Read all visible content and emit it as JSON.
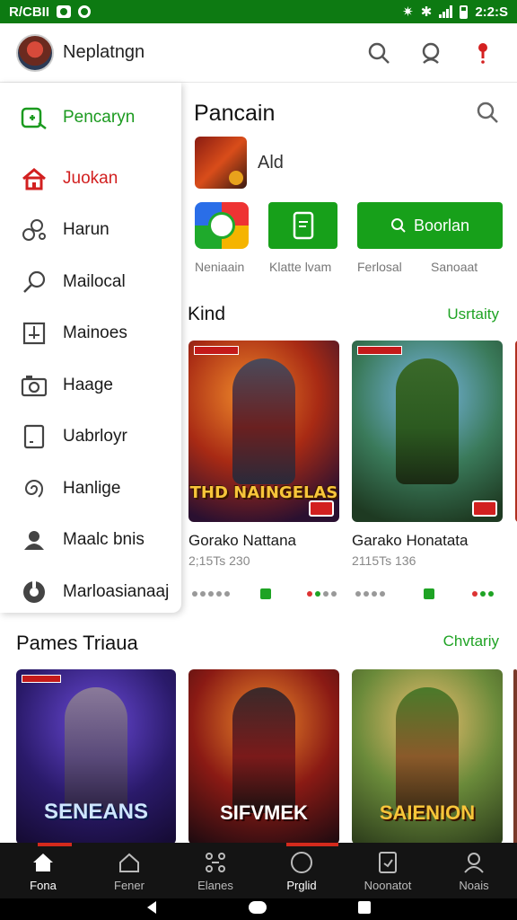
{
  "status_bar": {
    "left_text": "R/CBII",
    "time": "2:2:S"
  },
  "header": {
    "title": "Neplatngn"
  },
  "sidebar": {
    "items": [
      {
        "label": "Pencaryn",
        "icon": "controller-icon",
        "state": "active-green"
      },
      {
        "label": "Juokan",
        "icon": "home-icon",
        "state": "active-red"
      },
      {
        "label": "Harun",
        "icon": "gears-icon"
      },
      {
        "label": "Mailocal",
        "icon": "magnifier-icon"
      },
      {
        "label": "Mainoes",
        "icon": "board-icon"
      },
      {
        "label": "Haage",
        "icon": "camera-icon"
      },
      {
        "label": "Uabrloyr",
        "icon": "tablet-icon"
      },
      {
        "label": "Hanlige",
        "icon": "spiral-icon"
      },
      {
        "label": "Maalc bnis",
        "icon": "group-icon"
      },
      {
        "label": "Marloasianaaj",
        "icon": "circle-icon"
      }
    ]
  },
  "panel": {
    "title": "Pancain",
    "app_name": "Ald",
    "quick_actions": [
      {
        "label": "Neniaain",
        "icon": "multicolor-app-icon"
      },
      {
        "label": "Klatte lvam",
        "icon": "phone-icon"
      },
      {
        "label": "Ferlosal",
        "button_text": "Boorlan",
        "icon": "search-icon"
      },
      {
        "label": "Sanoaat"
      }
    ]
  },
  "kind_section": {
    "title": "Kind",
    "link": "Usrtaity",
    "games": [
      {
        "name": "Gorako Nattana",
        "meta": "2;15Ts 230",
        "logo": "THD NAINGELAS"
      },
      {
        "name": "Garako Honatata",
        "meta": "2115Ts 136",
        "logo": ""
      }
    ]
  },
  "rail_section": {
    "title": "Pames Triaua",
    "link": "Chvtariy",
    "games": [
      {
        "logo": "SENEANS"
      },
      {
        "logo": "SIFVMEK"
      },
      {
        "logo": "SAIENION"
      }
    ]
  },
  "bottom_nav": {
    "items": [
      {
        "label": "Fona",
        "icon": "home-icon",
        "active": true
      },
      {
        "label": "Fener",
        "icon": "house-outline-icon"
      },
      {
        "label": "Elanes",
        "icon": "grid-icon"
      },
      {
        "label": "Prglid",
        "icon": "compass-icon",
        "active": true
      },
      {
        "label": "Noonatot",
        "icon": "tablet-icon"
      },
      {
        "label": "Noais",
        "icon": "person-icon"
      }
    ]
  },
  "colors": {
    "status_green": "#0d7a12",
    "accent_green": "#17a01a",
    "accent_red": "#d22020",
    "nav_bg": "#141414"
  }
}
